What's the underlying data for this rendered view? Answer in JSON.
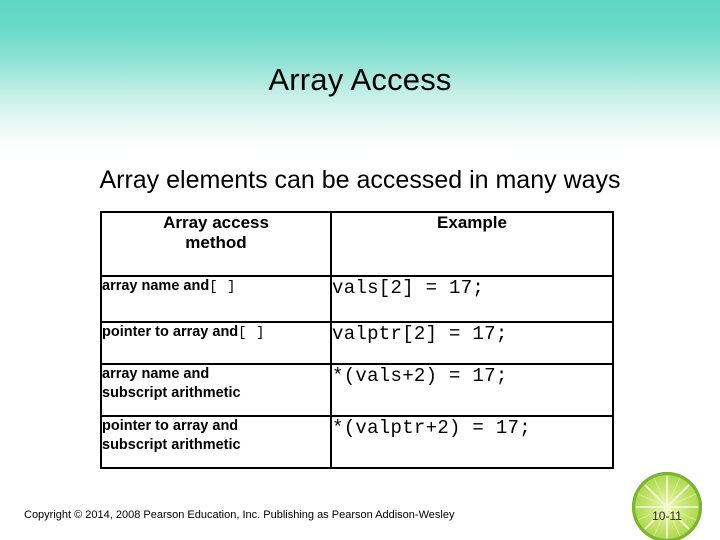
{
  "slide": {
    "title": "Array Access",
    "subtitle": "Array elements can be accessed in many ways",
    "accent_color": "#5fd6c3",
    "background_color": "#ffffff"
  },
  "table": {
    "headers": {
      "method_line1": "Array access",
      "method_line2": "method",
      "example": "Example"
    },
    "rows": [
      {
        "method_text": "array name and",
        "method_brackets": "[ ]",
        "method_line2": "",
        "example": "vals[2] = 17;"
      },
      {
        "method_text": "pointer to array and",
        "method_brackets": "[ ]",
        "method_line2": "",
        "example": "valptr[2] = 17;"
      },
      {
        "method_text": "array name and",
        "method_brackets": "",
        "method_line2": "subscript arithmetic",
        "example": "*(vals+2) = 17;"
      },
      {
        "method_text": "pointer to array and",
        "method_brackets": "",
        "method_line2": "subscript arithmetic",
        "example": "*(valptr+2) = 17;"
      }
    ]
  },
  "footer": {
    "copyright": "Copyright © 2014, 2008 Pearson Education, Inc. Publishing as Pearson Addison-Wesley",
    "page_number": "10-11",
    "decoration_icon": "lime-slice-icon"
  }
}
